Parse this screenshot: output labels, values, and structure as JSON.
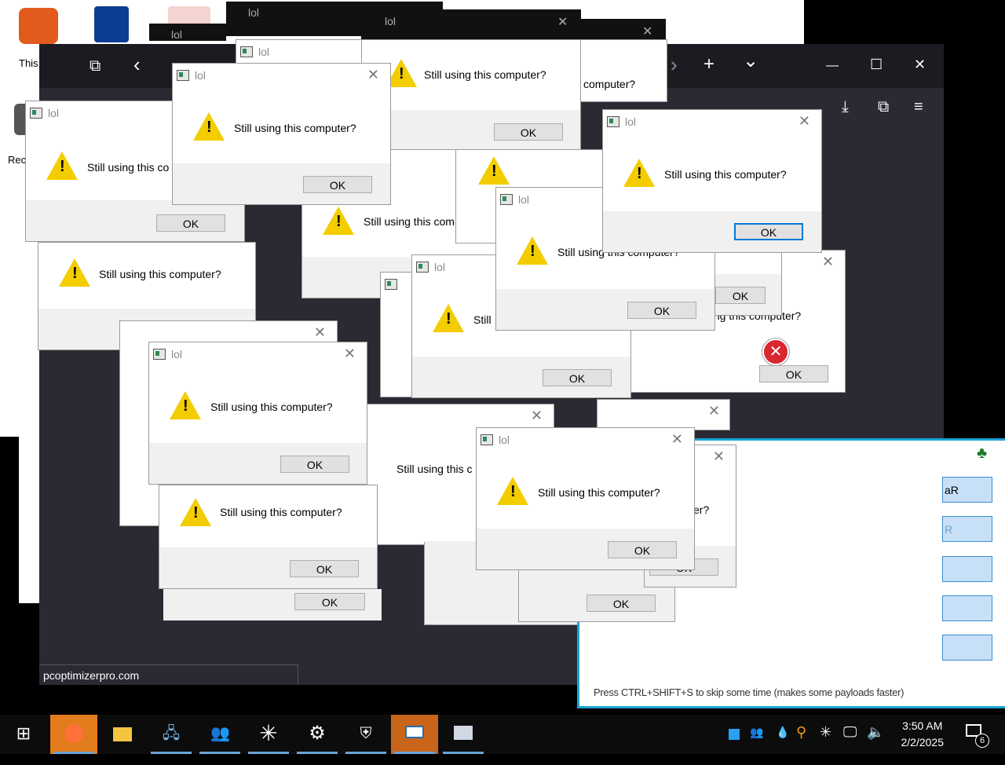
{
  "desktop": {
    "icon1_label": "This",
    "icon2_label": "Rec"
  },
  "browser": {
    "status_url": "pcoptimizerpro.com",
    "buttons": {
      "collections": "⧉",
      "back": "‹",
      "forward": "›",
      "new_tab": "+",
      "list_tabs": "⌄",
      "minimize": "—",
      "maximize": "☐",
      "close": "✕",
      "downloads": "⤓",
      "extensions": "⧉",
      "menu": "≡"
    }
  },
  "dialog": {
    "title": "lol",
    "message": "Still using this computer?",
    "ok": "OK",
    "close": "✕",
    "partial_message": "Still using this co",
    "partial_message2": "Still using this com",
    "partial_message3": "Still using this c",
    "partial_message4": "Still ",
    "partial_computer": "computer?",
    "partial_computer2": "er?",
    "partial_computer3": "using this computer?"
  },
  "overlay": {
    "press_text": "Press CTRL+SHIFT+S to skip some time (makes some payloads faster)",
    "side_button_1": "aR",
    "side_button_2": "R"
  },
  "taskbar": {
    "start_icon": "windows-logo-icon",
    "items": [
      "firefox-icon",
      "file-explorer-icon",
      "network-wizard-icon",
      "people-icon",
      "asterisk-icon",
      "settings-gear-icon",
      "shield-icon",
      "window-app-icon",
      "monitor-app-icon"
    ],
    "tray_icons": [
      "blue-square-icon",
      "people-tray-icon",
      "drop-icon",
      "search-key-icon",
      "star-icon",
      "network-icon",
      "volume-icon"
    ],
    "time": "3:50 AM",
    "date": "2/2/2025",
    "notification_count": "6"
  },
  "colors": {
    "accent_blue": "#0078d7",
    "warning_yellow": "#f3cd00",
    "highlight_frame": "#1aa3d6",
    "firefox_dark": "#2b2a33",
    "taskbar_active": "#e37c1c"
  }
}
